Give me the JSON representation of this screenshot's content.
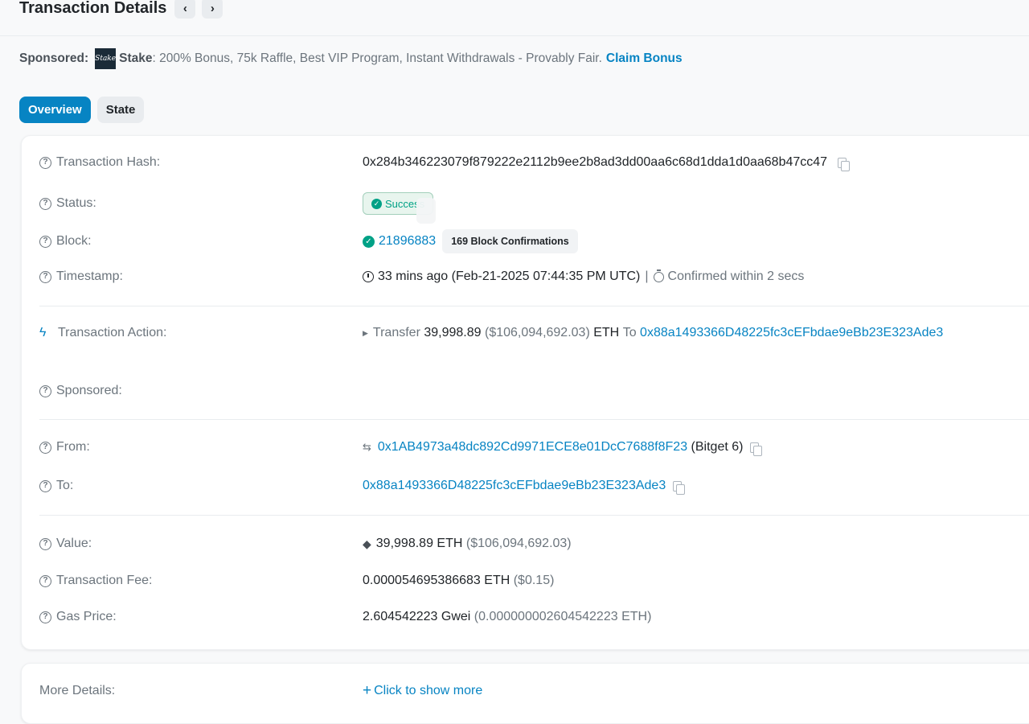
{
  "header": {
    "title": "Transaction Details",
    "prev": "‹",
    "next": "›"
  },
  "sponsored": {
    "label": "Sponsored:",
    "logo_text": "Stake",
    "brand": "Stake",
    "text": ": 200% Bonus, 75k Raffle, Best VIP Program, Instant Withdrawals - Provably Fair.",
    "cta": "Claim Bonus"
  },
  "tabs": [
    {
      "label": "Overview"
    },
    {
      "label": "State"
    }
  ],
  "details": {
    "hash": {
      "label": "Transaction Hash:",
      "value": "0x284b346223079f879222e2112b9ee2b8ad3dd00aa6c68d1dda1d0aa68b47cc47"
    },
    "status": {
      "label": "Status:",
      "value": "Success"
    },
    "block": {
      "label": "Block:",
      "value": "21896883",
      "confirmations": "169 Block Confirmations"
    },
    "timestamp": {
      "label": "Timestamp:",
      "value": "33 mins ago (Feb-21-2025 07:44:35 PM UTC)",
      "sep": "|",
      "confirmed": "Confirmed within 2 secs"
    },
    "action": {
      "label": "Transaction Action:",
      "verb": "Transfer",
      "amount": "39,998.89",
      "usd": "($106,094,692.03)",
      "unit": "ETH",
      "to_word": "To",
      "to": "0x88a1493366D48225fc3cEFbdae9eBb23E323Ade3"
    },
    "sponsored": {
      "label": "Sponsored:"
    },
    "from": {
      "label": "From:",
      "address": "0x1AB4973a48dc892Cd9971ECE8e01DcC7688f8F23",
      "tag": "(Bitget 6)"
    },
    "to": {
      "label": "To:",
      "address": "0x88a1493366D48225fc3cEFbdae9eBb23E323Ade3"
    },
    "value": {
      "label": "Value:",
      "amount": "39,998.89 ETH",
      "usd": "($106,094,692.03)"
    },
    "fee": {
      "label": "Transaction Fee:",
      "amount": "0.000054695386683 ETH",
      "usd": "($0.15)"
    },
    "gas": {
      "label": "Gas Price:",
      "amount": "2.604542223 Gwei",
      "eth": "(0.000000002604542223 ETH)"
    }
  },
  "more": {
    "label": "More Details:",
    "link": "Click to show more"
  },
  "colors": {
    "accent": "#0784c3",
    "success": "#00a186",
    "muted": "#6c757d"
  }
}
